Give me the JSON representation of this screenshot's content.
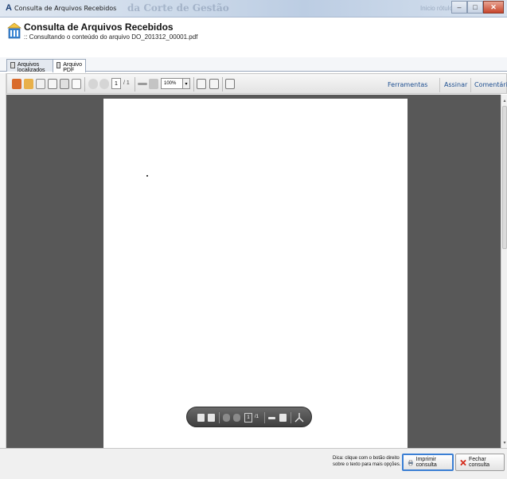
{
  "window": {
    "app_letter": "A",
    "title": "Consulta de Arquivos Recebidos",
    "background_title": "da Corte de Gestão",
    "background_right": "Inicio rótulo",
    "controls": {
      "minimize": "–",
      "maximize": "□",
      "close": "✕"
    }
  },
  "header": {
    "title": "Consulta de Arquivos Recebidos",
    "subtitle": ":: Consultando o conteúdo do arquivo DO_201312_00001.pdf"
  },
  "tabs": [
    {
      "label": "Arquivos localizados",
      "active": false
    },
    {
      "label": "Arquivo PDF",
      "active": true
    }
  ],
  "toolbar": {
    "page_current": "1",
    "page_total": "/ 1",
    "zoom": "100%",
    "zoom_dropdown": "▾",
    "links": [
      "Ferramentas",
      "Assinar",
      "Comentário"
    ]
  },
  "hud": {
    "page_current": "1",
    "page_total": "/1"
  },
  "scrollbar": {
    "up": "▴",
    "down": "▾"
  },
  "statusbar": {
    "hint": "Dica: clique com o botão direito sobre o texto para mais opções.",
    "print_button": "Imprimir consulta",
    "close_button": "Fechar consulta"
  },
  "colors": {
    "viewer_background": "#585858",
    "link": "#1d4f91",
    "primary_button_border": "#3b7fd4",
    "close_icon": "#d42a1a"
  }
}
